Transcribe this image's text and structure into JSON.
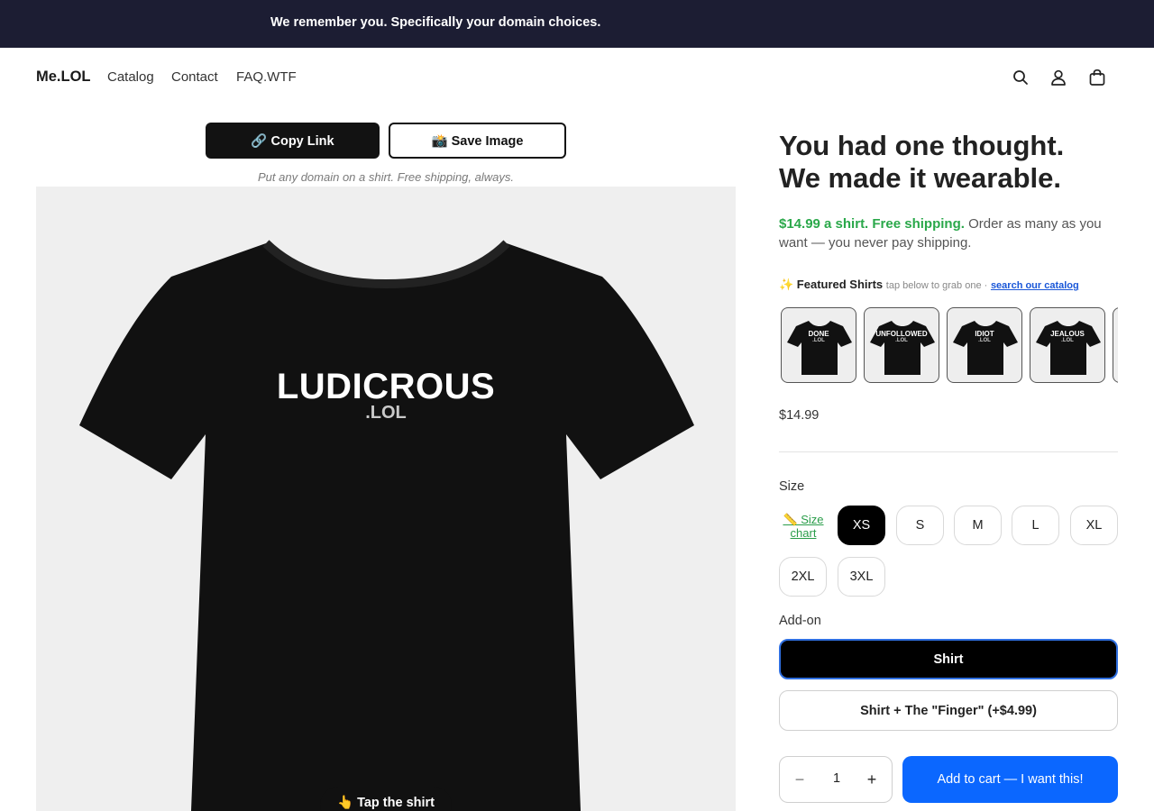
{
  "announcement": "We remember you. Specifically your domain choices.",
  "header": {
    "logo": "Me.LOL",
    "nav": [
      "Catalog",
      "Contact",
      "FAQ.WTF"
    ],
    "icons": [
      "search-icon",
      "account-icon",
      "cart-icon"
    ]
  },
  "share": {
    "copy_label": "🔗 Copy Link",
    "save_label": "📸 Save Image",
    "tagline": "Put any domain on a shirt. Free shipping, always."
  },
  "shirt": {
    "word": "LUDICROUS",
    "tld": ".LOL",
    "tap_label": "👆 Tap the shirt",
    "colors": {
      "shirt": "#111111",
      "background": "#efefef"
    }
  },
  "product": {
    "title_line1": "You had one thought.",
    "title_line2": "We made it wearable.",
    "price_highlight": "$14.99 a shirt. Free shipping.",
    "price_rest": " Order as many as you want — you never pay shipping.",
    "price": "$14.99"
  },
  "featured": {
    "title": "✨ Featured Shirts",
    "subtitle": "tap below to grab one ·",
    "link": "search our catalog",
    "items": [
      {
        "word": "DONE",
        "tld": ".LOL"
      },
      {
        "word": "UNFOLLOWED",
        "tld": ".LOL"
      },
      {
        "word": "IDIOT",
        "tld": ".LOL"
      },
      {
        "word": "JEALOUS",
        "tld": ".LOL"
      },
      {
        "word": "",
        "tld": ""
      }
    ]
  },
  "size": {
    "label": "Size",
    "chart_link": "📏 Size chart",
    "options": [
      "XS",
      "S",
      "M",
      "L",
      "XL",
      "2XL",
      "3XL"
    ],
    "selected": "XS"
  },
  "addon": {
    "label": "Add-on",
    "options": [
      "Shirt",
      "Shirt + The \"Finger\" (+$4.99)"
    ],
    "selected": "Shirt"
  },
  "cart": {
    "quantity": "1",
    "minus": "−",
    "plus": "+",
    "add_label": "Add to cart — I want this!"
  },
  "colors": {
    "announcement_bg": "#1c1d33",
    "accent_green": "#2aa84a",
    "accent_blue": "#0b67ff"
  }
}
